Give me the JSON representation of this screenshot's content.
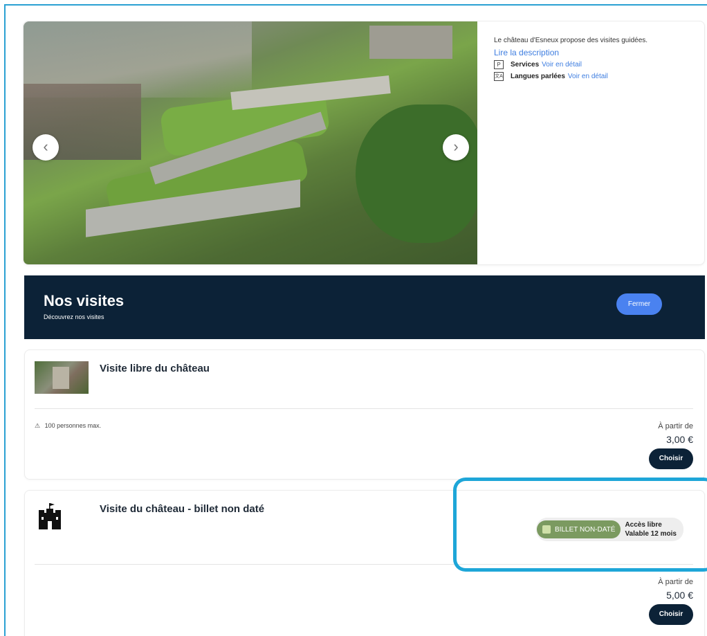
{
  "gallery": {
    "prev_icon": "‹",
    "next_icon": "›"
  },
  "info": {
    "description": "Le château d'Esneux propose des visites guidées.",
    "read_more": "Lire la description",
    "services_icon": "P",
    "services_label": "Services",
    "services_link": "Voir en détail",
    "languages_icon": "文A",
    "languages_label": "Langues parlées",
    "languages_link": "Voir en détail"
  },
  "banner": {
    "title": "Nos visites",
    "subtitle": "Découvrez nos visites",
    "close_label": "Fermer"
  },
  "visits": [
    {
      "name": "Visite libre du château",
      "capacity_icon": "⚠",
      "capacity": "100 personnes max.",
      "from_label": "À partir de",
      "price": "3,00 €",
      "choose_label": "Choisir"
    },
    {
      "name": "Visite du château - billet non daté",
      "ticket_badge": "BILLET NON-DATÉ",
      "access": "Accès libre",
      "validity": "Valable 12 mois",
      "from_label": "À partir de",
      "price": "5,00 €",
      "choose_label": "Choisir"
    }
  ],
  "colors": {
    "banner_bg": "#0c2237",
    "accent_blue": "#4a82f0",
    "link_blue": "#3d7de0",
    "badge_green": "#7b9a60",
    "highlight": "#1ea6d8"
  }
}
